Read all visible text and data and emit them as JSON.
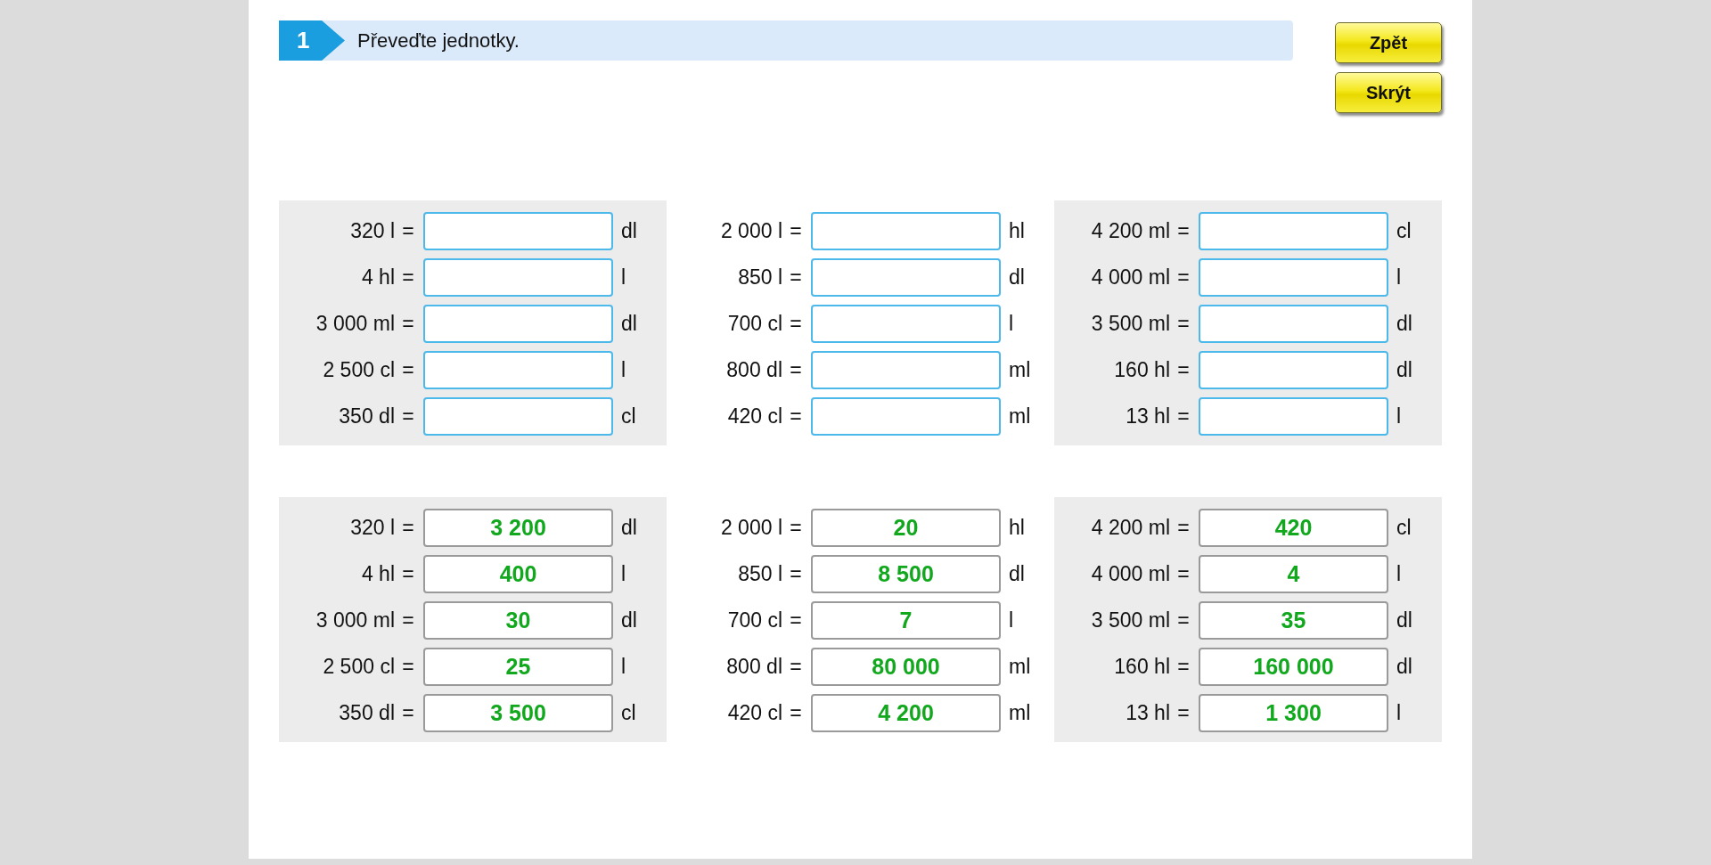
{
  "exercise": {
    "number": "1",
    "instruction": "Převeďte jednotky."
  },
  "buttons": [
    {
      "label": "Zpět"
    },
    {
      "label": "Skrýt"
    }
  ],
  "panels": [
    {
      "kind": "blank",
      "columns": [
        {
          "shaded": true,
          "rows": [
            {
              "quantity": "320 l",
              "sign": "=",
              "unit": "dl"
            },
            {
              "quantity": "4 hl",
              "sign": "=",
              "unit": "l"
            },
            {
              "quantity": "3 000 ml",
              "sign": "=",
              "unit": "dl"
            },
            {
              "quantity": "2 500 cl",
              "sign": "=",
              "unit": "l"
            },
            {
              "quantity": "350 dl",
              "sign": "=",
              "unit": "cl"
            }
          ]
        },
        {
          "shaded": false,
          "rows": [
            {
              "quantity": "2 000 l",
              "sign": "=",
              "unit": "hl"
            },
            {
              "quantity": "850 l",
              "sign": "=",
              "unit": "dl"
            },
            {
              "quantity": "700 cl",
              "sign": "=",
              "unit": "l"
            },
            {
              "quantity": "800 dl",
              "sign": "=",
              "unit": "ml"
            },
            {
              "quantity": "420 cl",
              "sign": "=",
              "unit": "ml"
            }
          ]
        },
        {
          "shaded": true,
          "rows": [
            {
              "quantity": "4 200 ml",
              "sign": "=",
              "unit": "cl"
            },
            {
              "quantity": "4 000 ml",
              "sign": "=",
              "unit": "l"
            },
            {
              "quantity": "3 500 ml",
              "sign": "=",
              "unit": "dl"
            },
            {
              "quantity": "160 hl",
              "sign": "=",
              "unit": "dl"
            },
            {
              "quantity": "13 hl",
              "sign": "=",
              "unit": "l"
            }
          ]
        }
      ]
    },
    {
      "kind": "solved",
      "columns": [
        {
          "shaded": true,
          "rows": [
            {
              "quantity": "320 l",
              "sign": "=",
              "answer": "3 200",
              "unit": "dl"
            },
            {
              "quantity": "4 hl",
              "sign": "=",
              "answer": "400",
              "unit": "l"
            },
            {
              "quantity": "3 000 ml",
              "sign": "=",
              "answer": "30",
              "unit": "dl"
            },
            {
              "quantity": "2 500 cl",
              "sign": "=",
              "answer": "25",
              "unit": "l"
            },
            {
              "quantity": "350 dl",
              "sign": "=",
              "answer": "3 500",
              "unit": "cl"
            }
          ]
        },
        {
          "shaded": false,
          "rows": [
            {
              "quantity": "2 000 l",
              "sign": "=",
              "answer": "20",
              "unit": "hl"
            },
            {
              "quantity": "850 l",
              "sign": "=",
              "answer": "8 500",
              "unit": "dl"
            },
            {
              "quantity": "700 cl",
              "sign": "=",
              "answer": "7",
              "unit": "l"
            },
            {
              "quantity": "800 dl",
              "sign": "=",
              "answer": "80 000",
              "unit": "ml"
            },
            {
              "quantity": "420 cl",
              "sign": "=",
              "answer": "4 200",
              "unit": "ml"
            }
          ]
        },
        {
          "shaded": true,
          "rows": [
            {
              "quantity": "4 200 ml",
              "sign": "=",
              "answer": "420",
              "unit": "cl"
            },
            {
              "quantity": "4 000 ml",
              "sign": "=",
              "answer": "4",
              "unit": "l"
            },
            {
              "quantity": "3 500 ml",
              "sign": "=",
              "answer": "35",
              "unit": "dl"
            },
            {
              "quantity": "160 hl",
              "sign": "=",
              "answer": "160 000",
              "unit": "dl"
            },
            {
              "quantity": "13 hl",
              "sign": "=",
              "answer": "1 300",
              "unit": "l"
            }
          ]
        }
      ]
    }
  ]
}
